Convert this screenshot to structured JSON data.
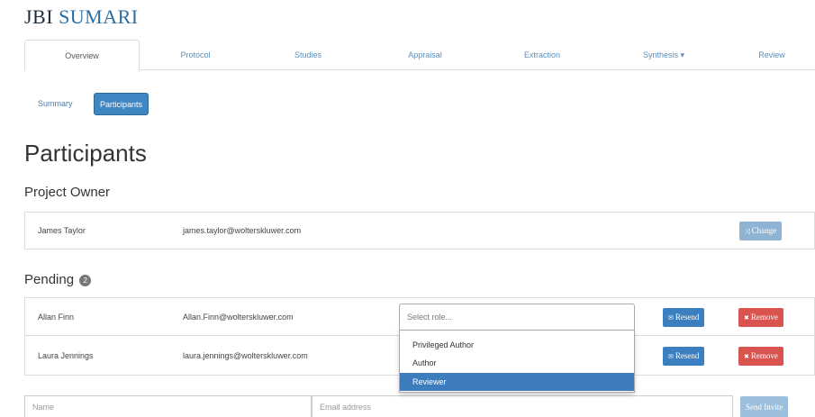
{
  "brand": {
    "prefix": "JBI",
    "name": "SUMARI"
  },
  "tabs": [
    {
      "label": "Overview"
    },
    {
      "label": "Protocol"
    },
    {
      "label": "Studies"
    },
    {
      "label": "Appraisal"
    },
    {
      "label": "Extraction"
    },
    {
      "label": "Synthesis ▾"
    },
    {
      "label": "Review"
    }
  ],
  "subnav": {
    "summary": "Summary",
    "participants": "Participants"
  },
  "page_title": "Participants",
  "owner": {
    "heading": "Project Owner",
    "name": "James Taylor",
    "email": "james.taylor@wolterskluwer.com",
    "change_label": "Change"
  },
  "pending": {
    "heading": "Pending",
    "count": "2",
    "rows": [
      {
        "name": "Allan Finn",
        "email": "Allan.Finn@wolterskluwer.com",
        "resend_label": "Resend",
        "remove_label": "Remove"
      },
      {
        "name": "Laura Jennings",
        "email": "laura.jennings@wolterskluwer.com",
        "resend_label": "Resend",
        "remove_label": "Remove"
      }
    ]
  },
  "role_select": {
    "placeholder": "Select role...",
    "options": [
      "Privileged Author",
      "Author",
      "Reviewer"
    ],
    "highlighted": "Reviewer"
  },
  "invite": {
    "name_placeholder": "Name",
    "email_placeholder": "Email address",
    "send_label": "Send Invite"
  },
  "colors": {
    "primary": "#3c7fc0",
    "danger": "#d9534f",
    "link": "#5a8fbd",
    "brand": "#2b6ea3"
  }
}
